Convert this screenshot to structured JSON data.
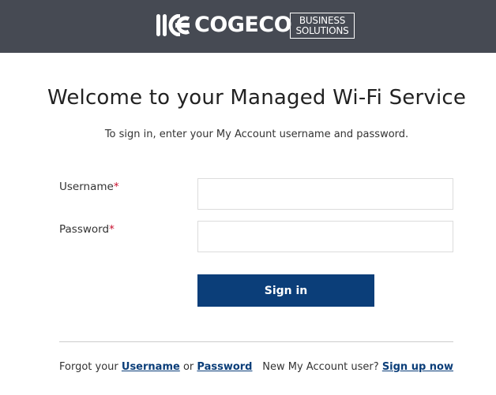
{
  "header": {
    "brand": "COGECO",
    "brand_badge_line1": "BUSINESS",
    "brand_badge_line2": "SOLUTIONS",
    "logo_icon": "cogeco-logo-icon",
    "background_color": "#464a53"
  },
  "main": {
    "title": "Welcome to your Managed Wi-Fi Service",
    "subtitle": "To sign in, enter your My Account username and password."
  },
  "form": {
    "username_label": "Username",
    "password_label": "Password",
    "required_marker": "*",
    "username_value": "",
    "password_value": "",
    "submit_label": "Sign in",
    "accent_color": "#0b3e79"
  },
  "footer": {
    "forgot_prefix": "Forgot your",
    "forgot_username_link": "Username",
    "forgot_or": "or",
    "forgot_password_link": "Password",
    "new_user_prefix": "New My Account user?",
    "signup_link": "Sign up now"
  }
}
